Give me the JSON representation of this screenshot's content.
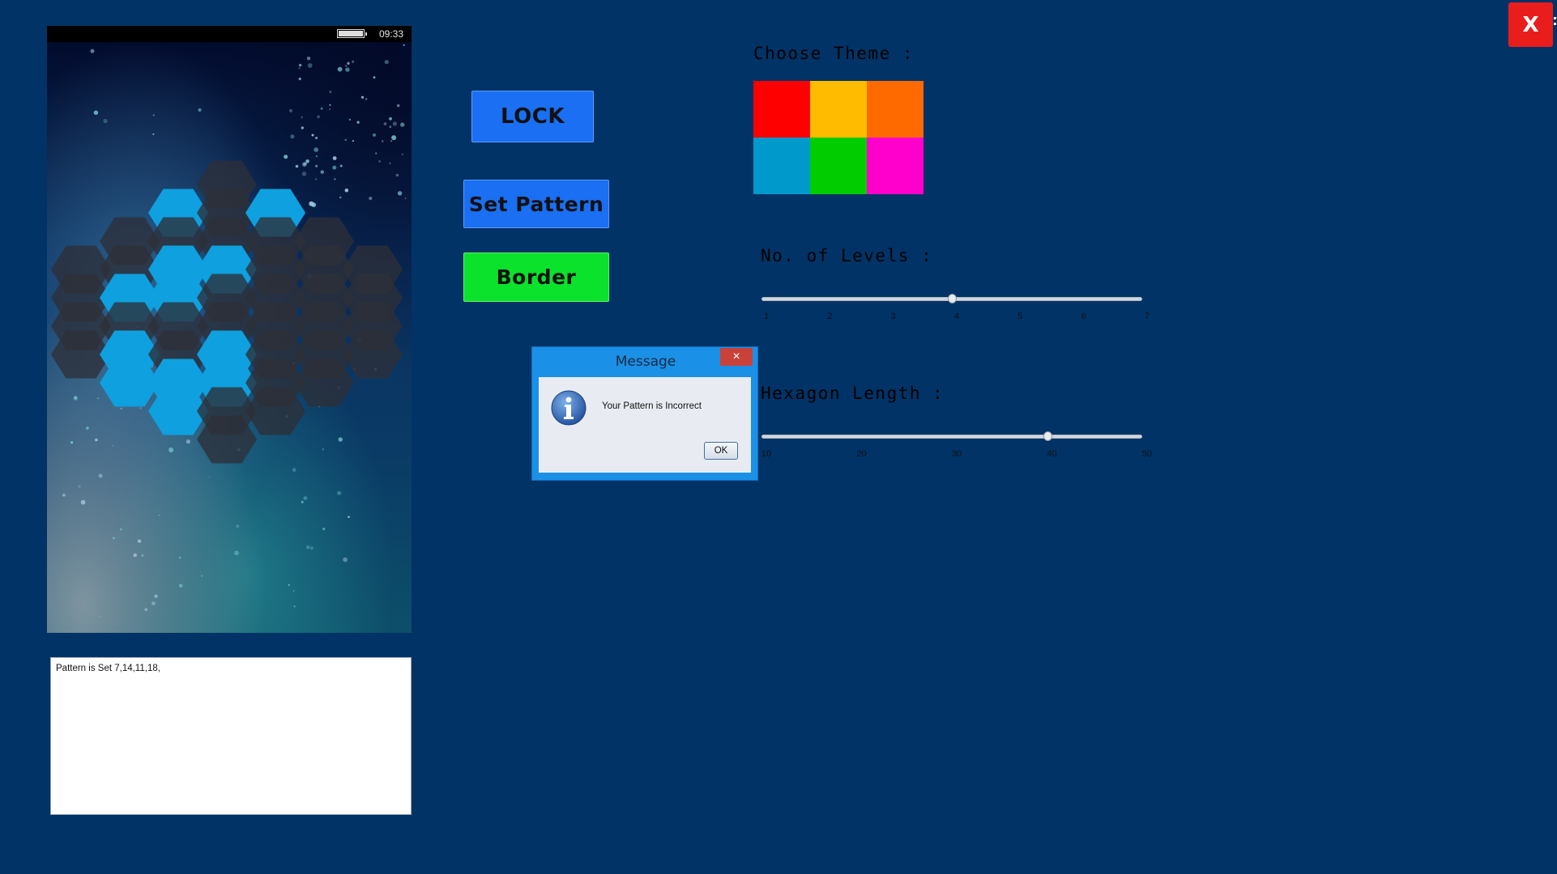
{
  "status_bar": {
    "time": "09:33",
    "battery_icon": "battery-icon"
  },
  "pattern": {
    "highlighted_color": "#0ea0df",
    "dim_color": "#2d2f38",
    "active_cells": [
      7,
      9,
      10,
      11,
      13,
      14,
      17,
      18,
      22,
      25,
      26,
      29
    ]
  },
  "log": {
    "text": "Pattern is Set 7,14,11,18,"
  },
  "buttons": {
    "lock": "LOCK",
    "set_pattern": "Set Pattern",
    "border": "Border"
  },
  "theme": {
    "label": "Choose Theme :",
    "swatches": [
      "#fe0000",
      "#ffbb00",
      "#ff6a00",
      "#0099cc",
      "#00cc00",
      "#ff00cc"
    ]
  },
  "levels": {
    "label": "No. of Levels :",
    "ticks": [
      "1",
      "2",
      "3",
      "4",
      "5",
      "6",
      "7"
    ],
    "min": 1,
    "max": 7,
    "value": 4
  },
  "hexagon_length": {
    "label": "Hexagon Length :",
    "ticks": [
      "10",
      "20",
      "30",
      "40",
      "50"
    ],
    "min": 10,
    "max": 50,
    "value": 40
  },
  "close_button": {
    "label": "X"
  },
  "dialog": {
    "title": "Message",
    "close_icon": "×",
    "message": "Your Pattern is Incorrect",
    "ok": "OK",
    "icon": "info-icon"
  }
}
